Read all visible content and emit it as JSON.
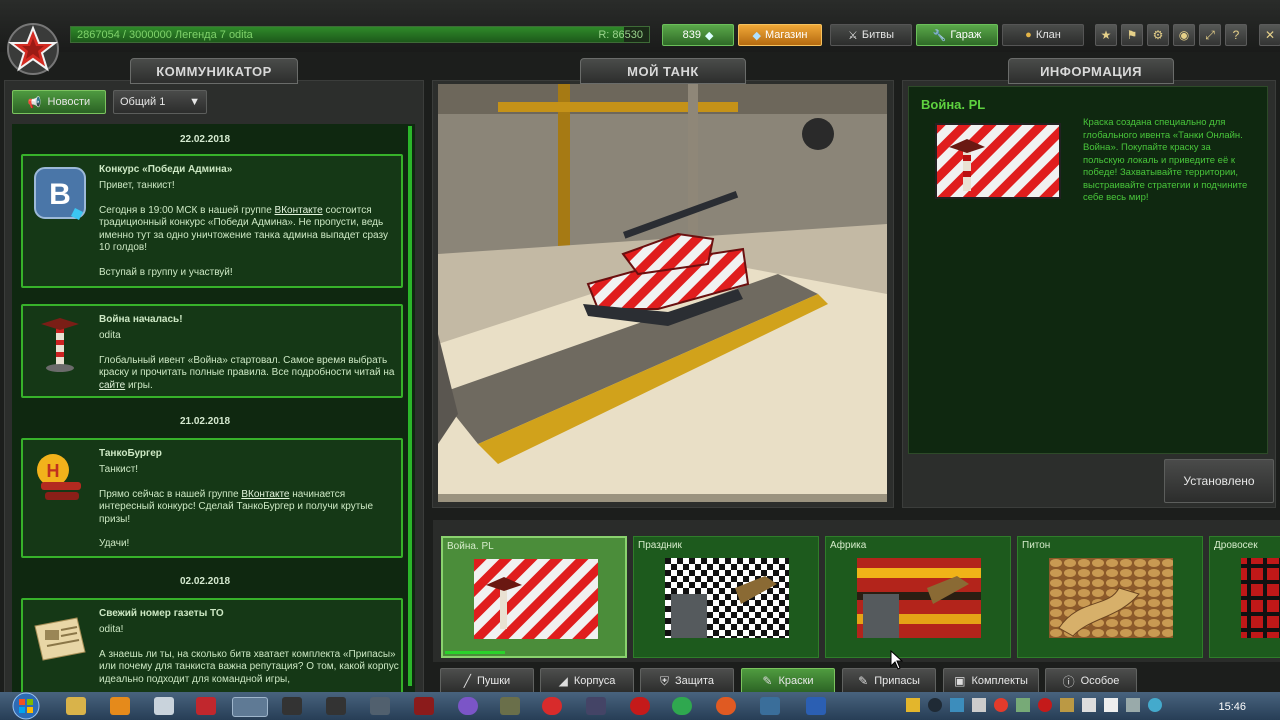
{
  "topbar": {
    "xp_text": "2867054 / 3000000  Легенда 7 odita",
    "xp_progress": 0.956,
    "rating": "R: 86530",
    "crystals": "839",
    "shop_label": "Магазин",
    "battles_label": "Битвы",
    "garage_label": "Гараж",
    "clan_label": "Клан"
  },
  "communicator": {
    "title": "КОММУНИКАТОР",
    "news_button": "Новости",
    "channel": "Общий 1",
    "items": [
      {
        "date": "22.02.2018",
        "title": "Конкурс «Победи Админа»",
        "greeting": "Привет, танкист!",
        "body_pre": "Сегодня в 19:00 МСК в нашей группе ",
        "link": "ВКонтакте",
        "body_post": " состоится традиционный конкурс «Победи Админа». Не пропусти, ведь именно тут за одно уничтожение танка админа выпадет сразу 10 голдов!",
        "footer": "Вступай в группу и участвуй!"
      },
      {
        "title": "Война началась!",
        "greeting": "odita",
        "body_pre": "Глобальный ивент «Война» стартовал. Самое время выбрать краску и прочитать полные правила. Все подробности читай на ",
        "link": "сайте",
        "body_post": " игры."
      },
      {
        "date": "21.02.2018",
        "title": "ТанкоБургер",
        "greeting": "Танкист!",
        "body_pre": "Прямо сейчас в нашей группе ",
        "link": "ВКонтакте",
        "body_post": " начинается интересный конкурс! Сделай ТанкоБургер и получи крутые призы!",
        "footer": "Удачи!"
      },
      {
        "date": "02.02.2018",
        "title": "Свежий номер газеты ТО",
        "greeting": "odita!",
        "body_pre": "А знаешь ли ты, на сколько битв хватает комплекта «Припасы» или почему для танкиста важна репутация? О том, какой корпус идеально подходит для командной игры, ",
        "link": "",
        "body_post": ""
      }
    ]
  },
  "mytank": {
    "title": "МОЙ ТАНК"
  },
  "info": {
    "title": "ИНФОРМАЦИЯ",
    "item_name": "Война. PL",
    "description": "Краска создана специально для глобального ивента «Танки Онлайн. Война». Покупайте краску за польскую локаль и приведите её к победе! Захватывайте территории, выстраивайте стратегии и подчините себе весь мир!",
    "installed_button": "Установлено"
  },
  "garage_items": [
    {
      "label": "Война. PL",
      "selected": true
    },
    {
      "label": "Праздник",
      "selected": false
    },
    {
      "label": "Африка",
      "selected": false
    },
    {
      "label": "Питон",
      "selected": false
    },
    {
      "label": "Дровосек",
      "selected": false
    }
  ],
  "categories": [
    "Пушки",
    "Корпуса",
    "Защита",
    "Краски",
    "Припасы",
    "Комплекты",
    "Особое"
  ],
  "active_category": "Краски",
  "taskbar": {
    "time": "15:46"
  },
  "colors": {
    "accent_green": "#37b22a",
    "shop_orange": "#f0a838",
    "text_green": "#49c63b"
  }
}
